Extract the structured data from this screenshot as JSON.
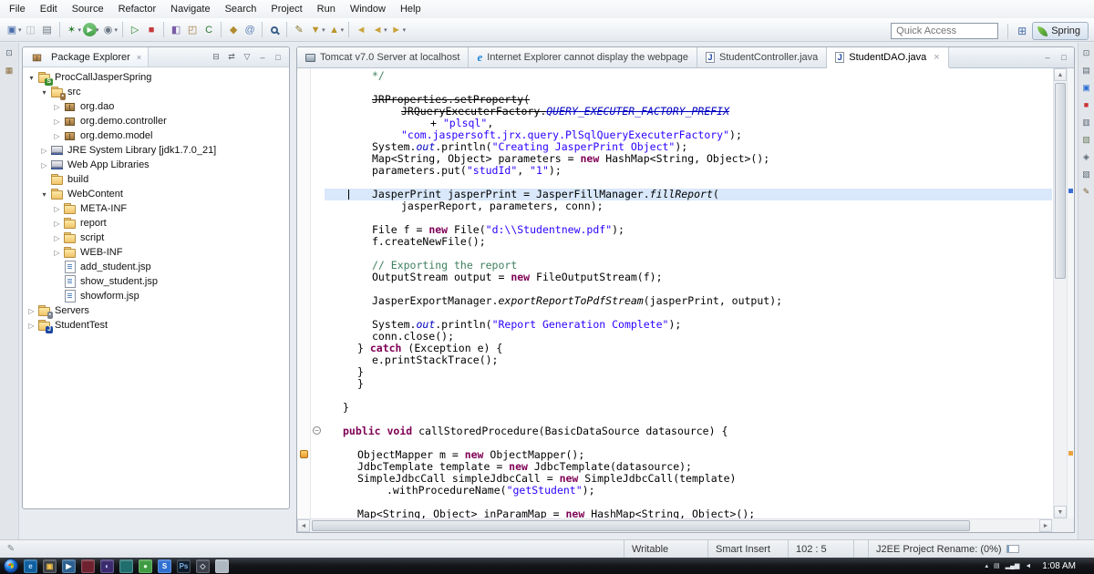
{
  "colors": {
    "keyword": "#7f0055",
    "string": "#2a00ff",
    "comment": "#3f7f5f",
    "static_field": "#0000c0",
    "current_line_highlight": "#d9e8fa",
    "taskbar_background": "#15171b"
  },
  "menu": {
    "items": [
      "File",
      "Edit",
      "Source",
      "Refactor",
      "Navigate",
      "Search",
      "Project",
      "Run",
      "Window",
      "Help"
    ]
  },
  "toolbar": {
    "quick_access": "Quick Access",
    "open_perspective_icon": "⊞",
    "perspective": {
      "label": "Spring"
    },
    "groups": [
      [
        {
          "name": "new-wizard-button",
          "glyph": "▣",
          "fg": "#4a6ea9",
          "dd": true
        },
        {
          "name": "save-button",
          "glyph": "◫",
          "fg": "#6b7683",
          "disabled": true
        },
        {
          "name": "print-button",
          "glyph": "▤",
          "fg": "#6b7683"
        }
      ],
      [
        {
          "name": "debug-button",
          "glyph": "✶",
          "fg": "#2d7d2d",
          "dd": true
        },
        {
          "name": "run-button",
          "glyph": "▶",
          "fg": "#ffffff",
          "bg": "#43a047",
          "round": true,
          "dd": true
        },
        {
          "name": "external-tools-button",
          "glyph": "◉",
          "fg": "#6b7683",
          "dd": true
        }
      ],
      [
        {
          "name": "start-server-button",
          "glyph": "▷",
          "fg": "#2d8a2d"
        },
        {
          "name": "stop-server-button",
          "glyph": "■",
          "fg": "#c63b3b"
        }
      ],
      [
        {
          "name": "new-java-project-button",
          "glyph": "◧",
          "fg": "#7a5ca8"
        },
        {
          "name": "new-package-button",
          "glyph": "◰",
          "fg": "#a07a3d"
        },
        {
          "name": "new-class-button",
          "glyph": "C",
          "fg": "#2e7d32"
        }
      ],
      [
        {
          "name": "jar-export-button",
          "glyph": "◆",
          "fg": "#b08b2e"
        },
        {
          "name": "javadoc-button",
          "glyph": "@",
          "fg": "#5b7fb4"
        }
      ],
      [
        {
          "name": "search-button",
          "glyph": "",
          "fg": "#3a5f8a",
          "mag": true
        }
      ],
      [
        {
          "name": "mark-occurrences-button",
          "glyph": "✎",
          "fg": "#8a7a2a"
        },
        {
          "name": "next-annotation-button",
          "glyph": "▼",
          "fg": "#b9972e",
          "dd": true
        },
        {
          "name": "previous-annotation-button",
          "glyph": "▲",
          "fg": "#b9972e",
          "dd": true
        }
      ],
      [
        {
          "name": "last-edit-location-button",
          "glyph": "◄",
          "fg": "#caa53d"
        },
        {
          "name": "back-button",
          "glyph": "◄",
          "fg": "#c9a23a",
          "dd": true
        },
        {
          "name": "forward-button",
          "glyph": "►",
          "fg": "#c9a23a",
          "dd": true
        }
      ]
    ]
  },
  "left_strip": [
    {
      "name": "restore-views-icon",
      "glyph": "⊡",
      "fg": "#5a6470"
    },
    {
      "name": "package-explorer-shortcut-icon",
      "glyph": "▦",
      "fg": "#8a6d3b"
    }
  ],
  "right_strip": [
    {
      "name": "restore-views-icon",
      "glyph": "⊡",
      "fg": "#5a6470"
    },
    {
      "name": "outline-view-icon",
      "glyph": "▤",
      "fg": "#5a6470"
    },
    {
      "name": "console-view-icon",
      "glyph": "▣",
      "fg": "#2f6fd0"
    },
    {
      "name": "servers-view-icon",
      "glyph": "■",
      "fg": "#cc3333"
    },
    {
      "name": "task-list-view-icon",
      "glyph": "▥",
      "fg": "#5a6470"
    },
    {
      "name": "snippets-view-icon",
      "glyph": "▨",
      "fg": "#6a7a5a"
    },
    {
      "name": "markers-view-icon",
      "glyph": "◈",
      "fg": "#5a6470"
    },
    {
      "name": "properties-view-icon",
      "glyph": "▧",
      "fg": "#5a6470"
    },
    {
      "name": "annotations-view-icon",
      "glyph": "✎",
      "fg": "#7a5a2a"
    }
  ],
  "package_explorer": {
    "title": "Package Explorer",
    "close_glyph": "×",
    "header_icons": [
      {
        "name": "collapse-all-button",
        "glyph": "⊟"
      },
      {
        "name": "link-with-editor-button",
        "glyph": "⇄"
      },
      {
        "name": "view-menu-button",
        "glyph": "▽"
      },
      {
        "name": "minimize-view-button",
        "glyph": "–"
      },
      {
        "name": "maximize-view-button",
        "glyph": "□"
      }
    ],
    "tree": [
      {
        "label": "ProcCallJasperSpring",
        "icon": "project-spring",
        "arrow": "expanded",
        "level": 0
      },
      {
        "label": "src",
        "icon": "source-folder",
        "arrow": "expanded",
        "level": 1
      },
      {
        "label": "org.dao",
        "icon": "package",
        "arrow": "collapsed",
        "level": 2
      },
      {
        "label": "org.demo.controller",
        "icon": "package",
        "arrow": "collapsed",
        "level": 2
      },
      {
        "label": "org.demo.model",
        "icon": "package",
        "arrow": "collapsed",
        "level": 2
      },
      {
        "label": "JRE System Library [jdk1.7.0_21]",
        "icon": "library",
        "arrow": "collapsed",
        "level": 1
      },
      {
        "label": "Web App Libraries",
        "icon": "library",
        "arrow": "collapsed",
        "level": 1
      },
      {
        "label": "build",
        "icon": "folder",
        "arrow": "none",
        "level": 1
      },
      {
        "label": "WebContent",
        "icon": "folder",
        "arrow": "expanded",
        "level": 1
      },
      {
        "label": "META-INF",
        "icon": "folder",
        "arrow": "collapsed",
        "level": 2
      },
      {
        "label": "report",
        "icon": "folder",
        "arrow": "collapsed",
        "level": 2
      },
      {
        "label": "script",
        "icon": "folder",
        "arrow": "collapsed",
        "level": 2
      },
      {
        "label": "WEB-INF",
        "icon": "folder",
        "arrow": "collapsed",
        "level": 2
      },
      {
        "label": "add_student.jsp",
        "icon": "jsp-file",
        "arrow": "none",
        "level": 2
      },
      {
        "label": "show_student.jsp",
        "icon": "jsp-file",
        "arrow": "none",
        "level": 2
      },
      {
        "label": "showform.jsp",
        "icon": "jsp-file",
        "arrow": "none",
        "level": 2
      },
      {
        "label": "Servers",
        "icon": "servers-project",
        "arrow": "collapsed",
        "level": 0
      },
      {
        "label": "StudentTest",
        "icon": "java-project",
        "arrow": "collapsed",
        "level": 0
      }
    ]
  },
  "editor": {
    "tabs": [
      {
        "label": "Tomcat v7.0 Server at localhost",
        "icon": "server",
        "active": false
      },
      {
        "label": "Internet Explorer cannot display the webpage",
        "icon": "ie",
        "active": false
      },
      {
        "label": "StudentController.java",
        "icon": "java",
        "active": false
      },
      {
        "label": "StudentDAO.java",
        "icon": "java",
        "active": true,
        "close": "×"
      }
    ],
    "header_icons": [
      {
        "name": "minimize-editor-button",
        "glyph": "–"
      },
      {
        "name": "maximize-editor-button",
        "glyph": "□"
      }
    ],
    "code": {
      "lines": [
        {
          "ind": 3,
          "tok": [
            {
              "t": "*/",
              "s": "c"
            }
          ]
        },
        {
          "ind": 0,
          "tok": []
        },
        {
          "ind": 3,
          "tok": [
            {
              "t": "JRProperties.setProperty(",
              "s": "d dep"
            }
          ]
        },
        {
          "ind": 5,
          "tok": [
            {
              "t": "JRQueryExecuterFactory.",
              "s": "d dep"
            },
            {
              "t": "QUERY_EXECUTER_FACTORY_PREFIX",
              "s": "st dep"
            }
          ]
        },
        {
          "ind": 7,
          "tok": [
            {
              "t": "+ ",
              "s": "d"
            },
            {
              "t": "\"plsql\"",
              "s": "s"
            },
            {
              "t": ",",
              "s": "d"
            }
          ]
        },
        {
          "ind": 5,
          "tok": [
            {
              "t": "\"com.jaspersoft.jrx.query.PlSqlQueryExecuterFactory\"",
              "s": "s"
            },
            {
              "t": ");",
              "s": "d"
            }
          ]
        },
        {
          "ind": 3,
          "tok": [
            {
              "t": "System.",
              "s": "d"
            },
            {
              "t": "out",
              "s": "st"
            },
            {
              "t": ".println(",
              "s": "d"
            },
            {
              "t": "\"Creating JasperPrint Object\"",
              "s": "s"
            },
            {
              "t": ");",
              "s": "d"
            }
          ]
        },
        {
          "ind": 3,
          "tok": [
            {
              "t": "Map<String, Object> parameters = ",
              "s": "d"
            },
            {
              "t": "new",
              "s": "k"
            },
            {
              "t": " HashMap<String, Object>();",
              "s": "d"
            }
          ]
        },
        {
          "ind": 3,
          "tok": [
            {
              "t": "parameters.put(",
              "s": "d"
            },
            {
              "t": "\"studId\"",
              "s": "s"
            },
            {
              "t": ", ",
              "s": "d"
            },
            {
              "t": "\"1\"",
              "s": "s"
            },
            {
              "t": ");",
              "s": "d"
            }
          ]
        },
        {
          "ind": 0,
          "tok": []
        },
        {
          "ind": 3,
          "hl": true,
          "caret": 26,
          "tok": [
            {
              "t": "JasperPrint jasperPrint = JasperFillManager.",
              "s": "d"
            },
            {
              "t": "fillReport",
              "s": "sm"
            },
            {
              "t": "(",
              "s": "d"
            }
          ]
        },
        {
          "ind": 5,
          "tok": [
            {
              "t": "jasperReport, parameters, conn);",
              "s": "d"
            }
          ]
        },
        {
          "ind": 0,
          "tok": []
        },
        {
          "ind": 3,
          "tok": [
            {
              "t": "File f = ",
              "s": "d"
            },
            {
              "t": "new",
              "s": "k"
            },
            {
              "t": " File(",
              "s": "d"
            },
            {
              "t": "\"d:\\\\Studentnew.pdf\"",
              "s": "s"
            },
            {
              "t": ");",
              "s": "d"
            }
          ]
        },
        {
          "ind": 3,
          "tok": [
            {
              "t": "f.createNewFile();",
              "s": "d"
            }
          ]
        },
        {
          "ind": 0,
          "tok": []
        },
        {
          "ind": 3,
          "tok": [
            {
              "t": "// Exporting the report",
              "s": "c"
            }
          ]
        },
        {
          "ind": 3,
          "tok": [
            {
              "t": "OutputStream output = ",
              "s": "d"
            },
            {
              "t": "new",
              "s": "k"
            },
            {
              "t": " FileOutputStream(f);",
              "s": "d"
            }
          ]
        },
        {
          "ind": 0,
          "tok": []
        },
        {
          "ind": 3,
          "tok": [
            {
              "t": "JasperExportManager.",
              "s": "d"
            },
            {
              "t": "exportReportToPdfStream",
              "s": "sm"
            },
            {
              "t": "(jasperPrint, output);",
              "s": "d"
            }
          ]
        },
        {
          "ind": 0,
          "tok": []
        },
        {
          "ind": 3,
          "tok": [
            {
              "t": "System.",
              "s": "d"
            },
            {
              "t": "out",
              "s": "st"
            },
            {
              "t": ".println(",
              "s": "d"
            },
            {
              "t": "\"Report Generation Complete\"",
              "s": "s"
            },
            {
              "t": ");",
              "s": "d"
            }
          ]
        },
        {
          "ind": 3,
          "tok": [
            {
              "t": "conn.close();",
              "s": "d"
            }
          ]
        },
        {
          "ind": 2,
          "tok": [
            {
              "t": "} ",
              "s": "d"
            },
            {
              "t": "catch",
              "s": "k"
            },
            {
              "t": " (Exception e) {",
              "s": "d"
            }
          ]
        },
        {
          "ind": 3,
          "tok": [
            {
              "t": "e.printStackTrace();",
              "s": "d"
            }
          ]
        },
        {
          "ind": 2,
          "tok": [
            {
              "t": "}",
              "s": "d"
            }
          ]
        },
        {
          "ind": 2,
          "tok": [
            {
              "t": "}",
              "s": "d"
            }
          ]
        },
        {
          "ind": 0,
          "tok": []
        },
        {
          "ind": 1,
          "tok": [
            {
              "t": "}",
              "s": "d"
            }
          ]
        },
        {
          "ind": 0,
          "tok": []
        },
        {
          "ind": 1,
          "fold": true,
          "tok": [
            {
              "t": "public",
              "s": "k"
            },
            {
              "t": " ",
              "s": "d"
            },
            {
              "t": "void",
              "s": "k"
            },
            {
              "t": " callStoredProcedure(BasicDataSource datasource) {",
              "s": "d"
            }
          ]
        },
        {
          "ind": 0,
          "tok": []
        },
        {
          "ind": 2,
          "marker": true,
          "tok": [
            {
              "t": "ObjectMapper m = ",
              "s": "d"
            },
            {
              "t": "new",
              "s": "k"
            },
            {
              "t": " ObjectMapper();",
              "s": "d"
            }
          ]
        },
        {
          "ind": 2,
          "tok": [
            {
              "t": "JdbcTemplate template = ",
              "s": "d"
            },
            {
              "t": "new",
              "s": "k"
            },
            {
              "t": " JdbcTemplate(datasource);",
              "s": "d"
            }
          ]
        },
        {
          "ind": 2,
          "tok": [
            {
              "t": "SimpleJdbcCall simpleJdbcCall = ",
              "s": "d"
            },
            {
              "t": "new",
              "s": "k"
            },
            {
              "t": " SimpleJdbcCall(template)",
              "s": "d"
            }
          ]
        },
        {
          "ind": 4,
          "tok": [
            {
              "t": ".withProcedureName(",
              "s": "d"
            },
            {
              "t": "\"getStudent\"",
              "s": "s"
            },
            {
              "t": ");",
              "s": "d"
            }
          ]
        },
        {
          "ind": 0,
          "tok": []
        },
        {
          "ind": 2,
          "tok": [
            {
              "t": "Map<String, Object> inParamMap = ",
              "s": "d"
            },
            {
              "t": "new",
              "s": "k"
            },
            {
              "t": " HashMap<String, Object>();",
              "s": "d"
            }
          ]
        }
      ]
    }
  },
  "status_bar": {
    "writable": "Writable",
    "input_mode": "Smart Insert",
    "caret_position": "102 : 5",
    "progress_label": "J2EE Project Rename: (0%)"
  },
  "taskbar": {
    "clock": "1:08 AM",
    "apps": [
      {
        "name": "internet-explorer-icon",
        "color": "#0f5f9e",
        "glyph": "e",
        "fg": "#bfe2ff"
      },
      {
        "name": "windows-explorer-icon",
        "color": "#3b3f45",
        "glyph": "▣",
        "fg": "#f4c54a"
      },
      {
        "name": "media-player-icon",
        "color": "#2b5f8f",
        "glyph": "▶",
        "fg": "#ffffff"
      },
      {
        "name": "pinned-app-icon-4",
        "color": "#6e2230",
        "glyph": "",
        "fg": "#ffffff"
      },
      {
        "name": "eclipse-icon",
        "color": "#3b2a6e",
        "glyph": "◐",
        "fg": "#cfd8ff"
      },
      {
        "name": "pinned-app-icon-6",
        "color": "#1f6d6d",
        "glyph": "",
        "fg": "#ffffff"
      },
      {
        "name": "pinned-app-icon-7",
        "color": "#3f9b41",
        "glyph": "●",
        "fg": "#e2ffe2"
      },
      {
        "name": "pinned-app-icon-8",
        "color": "#2f6fd0",
        "glyph": "S",
        "fg": "#ffffff"
      },
      {
        "name": "photoshop-icon",
        "color": "#0d1b2a",
        "glyph": "Ps",
        "fg": "#7fb3e8"
      },
      {
        "name": "pinned-app-icon-10",
        "color": "#3a3f4a",
        "glyph": "◇",
        "fg": "#cfd8dd"
      },
      {
        "name": "pinned-app-icon-11",
        "color": "#aeb6bf",
        "glyph": "",
        "fg": "#333333"
      }
    ],
    "tray": [
      {
        "name": "tray-expand-icon",
        "glyph": "▴"
      },
      {
        "name": "tray-display-icon",
        "glyph": "▤"
      },
      {
        "name": "tray-network-icon",
        "glyph": "▂▄▆"
      },
      {
        "name": "tray-volume-icon",
        "glyph": "◄"
      }
    ]
  }
}
